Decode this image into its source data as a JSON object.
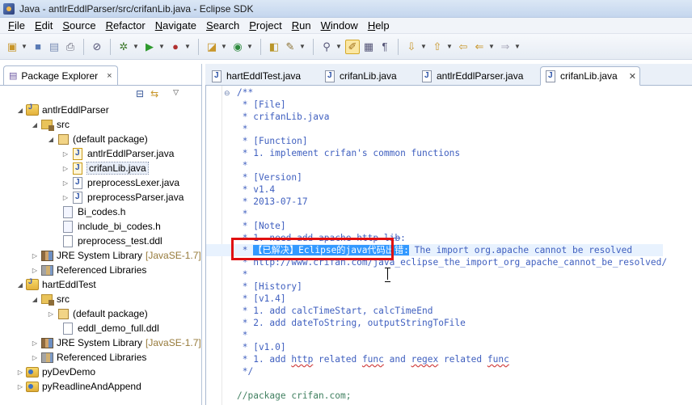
{
  "window": {
    "title": "Java - antlrEddlParser/src/crifanLib.java - Eclipse SDK"
  },
  "menu": [
    "File",
    "Edit",
    "Source",
    "Refactor",
    "Navigate",
    "Search",
    "Project",
    "Run",
    "Window",
    "Help"
  ],
  "explorer": {
    "tab_label": "Package Explorer",
    "close": "×",
    "tree": [
      {
        "label": "antlrEddlParser",
        "decoration": "",
        "expanded": true,
        "icon": "project"
      },
      {
        "label": "src",
        "decoration": "",
        "expanded": true,
        "icon": "source-folder"
      },
      {
        "label": "(default package)",
        "decoration": "",
        "expanded": true,
        "icon": "package"
      },
      {
        "label": "antlrEddlParser.java",
        "decoration": "",
        "expanded": false,
        "icon": "java-file"
      },
      {
        "label": "crifanLib.java",
        "decoration": "",
        "expanded": false,
        "icon": "java-file"
      },
      {
        "label": "preprocessLexer.java",
        "decoration": "",
        "expanded": false,
        "icon": "java-file"
      },
      {
        "label": "preprocessParser.java",
        "decoration": "",
        "expanded": false,
        "icon": "java-file"
      },
      {
        "label": "Bi_codes.h",
        "decoration": "",
        "expanded": false,
        "icon": "file"
      },
      {
        "label": "include_bi_codes.h",
        "decoration": "",
        "expanded": false,
        "icon": "file"
      },
      {
        "label": "preprocess_test.ddl",
        "decoration": "",
        "expanded": false,
        "icon": "file"
      },
      {
        "label": "JRE System Library",
        "decoration": "[JavaSE-1.7]",
        "expanded": false,
        "icon": "library"
      },
      {
        "label": "Referenced Libraries",
        "decoration": "",
        "expanded": false,
        "icon": "ref-library"
      },
      {
        "label": "hartEddlTest",
        "decoration": "",
        "expanded": true,
        "icon": "project"
      },
      {
        "label": "src",
        "decoration": "",
        "expanded": true,
        "icon": "source-folder"
      },
      {
        "label": "(default package)",
        "decoration": "",
        "expanded": false,
        "icon": "package"
      },
      {
        "label": "eddl_demo_full.ddl",
        "decoration": "",
        "expanded": false,
        "icon": "file"
      },
      {
        "label": "JRE System Library",
        "decoration": "[JavaSE-1.7]",
        "expanded": false,
        "icon": "library"
      },
      {
        "label": "Referenced Libraries",
        "decoration": "",
        "expanded": false,
        "icon": "ref-library"
      },
      {
        "label": "pyDevDemo",
        "decoration": "",
        "expanded": false,
        "icon": "pydev-project"
      },
      {
        "label": "pyReadlineAndAppend",
        "decoration": "",
        "expanded": false,
        "icon": "pydev-project"
      }
    ]
  },
  "editor": {
    "tabs": [
      {
        "label": "hartEddlTest.java"
      },
      {
        "label": "crifanLib.java"
      },
      {
        "label": "antlrEddlParser.java"
      },
      {
        "label": "crifanLib.java"
      }
    ],
    "lines": {
      "l1": "/**",
      "l2": " * [File]",
      "l3": " * crifanLib.java",
      "l4": " *",
      "l5": " * [Function]",
      "l6": " * 1. implement crifan's common functions",
      "l7": " *",
      "l8": " * [Version]",
      "l9": " * v1.4",
      "l10": " * 2013-07-17",
      "l11": " *",
      "l12": " * [Note]",
      "l13a": " * 1. need add ",
      "l13b": "apache http lib",
      "l13c": ":",
      "l14a": " * ",
      "l14b": "【已解决】Eclipse的java代码出错:",
      "l14c": " The import org.apache cannot be resolved",
      "l15": " * http://www.crifan.com/java_eclipse_the_import_org_apache_cannot_be_resolved/",
      "l16": " *",
      "l17": " * [History]",
      "l18": " * [v1.4]",
      "l19": " * 1. add calcTimeStart, calcTimeEnd",
      "l20": " * 2. add dateToString, outputStringToFile",
      "l21": " *",
      "l22": " * [v1.0]",
      "l23a": " * 1. add ",
      "l23b": "http",
      "l23c": " related ",
      "l23d": "func",
      "l23e": " and ",
      "l23f": "regex",
      "l23g": " related ",
      "l23h": "func",
      "l24": " */",
      "l25": "",
      "l26": "//package crifan.com;"
    }
  }
}
